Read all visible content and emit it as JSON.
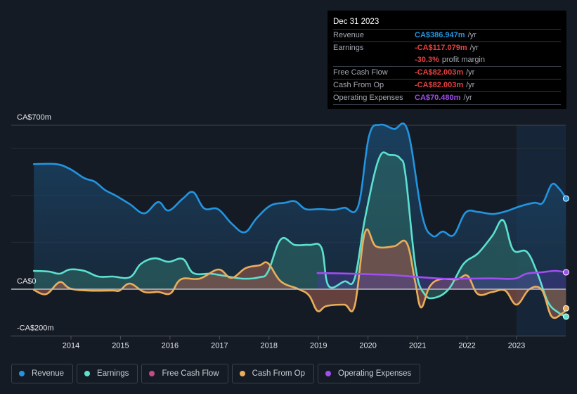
{
  "tooltip": {
    "date": "Dec 31 2023",
    "rows": [
      {
        "label": "Revenue",
        "value": "CA$386.947m",
        "unit": "/yr",
        "color": "#2394df"
      },
      {
        "label": "Earnings",
        "value": "-CA$117.079m",
        "unit": "/yr",
        "color": "#e64141"
      },
      {
        "label": "",
        "value": "-30.3%",
        "unit": "profit margin",
        "color": "#e64141"
      },
      {
        "label": "Free Cash Flow",
        "value": "-CA$82.003m",
        "unit": "/yr",
        "color": "#e64141"
      },
      {
        "label": "Cash From Op",
        "value": "-CA$82.003m",
        "unit": "/yr",
        "color": "#e64141"
      },
      {
        "label": "Operating Expenses",
        "value": "CA$70.480m",
        "unit": "/yr",
        "color": "#a04ef0"
      }
    ]
  },
  "legend": [
    {
      "label": "Revenue",
      "color": "#2394df"
    },
    {
      "label": "Earnings",
      "color": "#5ce1cf"
    },
    {
      "label": "Free Cash Flow",
      "color": "#c44b87"
    },
    {
      "label": "Cash From Op",
      "color": "#e9ae5b"
    },
    {
      "label": "Operating Expenses",
      "color": "#a04ef0"
    }
  ],
  "chart_data": {
    "type": "area",
    "title": "",
    "xlabel": "",
    "ylabel": "",
    "y_unit": "CA$m",
    "ylim": [
      -200,
      700
    ],
    "xlim": [
      2013.25,
      2024.0
    ],
    "y_tick_labels": [
      {
        "value": 700,
        "label": "CA$700m"
      },
      {
        "value": 0,
        "label": "CA$0"
      },
      {
        "value": -200,
        "label": "-CA$200m"
      }
    ],
    "gridlines": [
      700,
      600,
      400,
      200,
      0,
      -200
    ],
    "x_ticks": [
      2014,
      2015,
      2016,
      2017,
      2018,
      2019,
      2020,
      2021,
      2022,
      2023
    ],
    "forecast_shade_from": 2023.0,
    "grid": true,
    "legend_position": "bottom",
    "series": [
      {
        "name": "Revenue",
        "color": "#2394df",
        "x": [
          2013.25,
          2013.7,
          2013.98,
          2014.27,
          2014.48,
          2014.69,
          2014.91,
          2015.19,
          2015.48,
          2015.76,
          2015.97,
          2016.26,
          2016.47,
          2016.69,
          2016.97,
          2017.25,
          2017.51,
          2017.75,
          2018.03,
          2018.32,
          2018.53,
          2018.74,
          2019.03,
          2019.31,
          2019.52,
          2019.8,
          2020.02,
          2020.24,
          2020.52,
          2020.8,
          2021.09,
          2021.3,
          2021.51,
          2021.73,
          2021.97,
          2022.22,
          2022.51,
          2022.79,
          2023.07,
          2023.36,
          2023.53,
          2023.71,
          2023.86,
          2024.0
        ],
        "values": [
          534,
          534,
          513,
          474,
          459,
          423,
          399,
          363,
          324,
          372,
          336,
          387,
          414,
          345,
          342,
          279,
          243,
          303,
          357,
          369,
          375,
          342,
          342,
          339,
          348,
          354,
          654,
          702,
          684,
          678,
          318,
          228,
          246,
          231,
          327,
          330,
          321,
          333,
          354,
          369,
          369,
          447,
          429,
          387
        ]
      },
      {
        "name": "Earnings",
        "color": "#5ce1cf",
        "x": [
          2013.25,
          2013.56,
          2013.77,
          2013.98,
          2014.27,
          2014.55,
          2014.84,
          2015.19,
          2015.41,
          2015.69,
          2015.97,
          2016.26,
          2016.47,
          2016.82,
          2017.1,
          2017.46,
          2017.81,
          2017.98,
          2018.24,
          2018.52,
          2018.81,
          2019.06,
          2019.2,
          2019.52,
          2019.73,
          2019.94,
          2020.22,
          2020.44,
          2020.65,
          2020.76,
          2020.96,
          2021.14,
          2021.36,
          2021.64,
          2021.93,
          2022.22,
          2022.51,
          2022.73,
          2022.93,
          2023.21,
          2023.43,
          2023.64,
          2023.86,
          2024.0
        ],
        "values": [
          78,
          75,
          66,
          84,
          78,
          54,
          54,
          51,
          108,
          132,
          117,
          129,
          69,
          66,
          57,
          45,
          51,
          75,
          213,
          189,
          189,
          177,
          15,
          33,
          45,
          303,
          558,
          573,
          558,
          483,
          93,
          -21,
          -36,
          3,
          108,
          153,
          228,
          294,
          168,
          159,
          63,
          -57,
          -102,
          -117
        ]
      },
      {
        "name": "Free Cash Flow",
        "color": "#c44b87",
        "x": [
          2013.25,
          2013.5,
          2013.77,
          2013.98,
          2014.34,
          2014.84,
          2014.98,
          2015.19,
          2015.48,
          2015.76,
          2016.01,
          2016.22,
          2016.6,
          2016.98,
          2017.24,
          2017.53,
          2017.81,
          2017.98,
          2018.24,
          2018.6,
          2018.81,
          2018.98,
          2019.16,
          2019.52,
          2019.73,
          2019.94,
          2020.16,
          2020.52,
          2020.78,
          2020.95,
          2021.07,
          2021.24,
          2021.45,
          2021.8,
          2022.01,
          2022.22,
          2022.51,
          2022.77,
          2023.0,
          2023.26,
          2023.51,
          2023.71,
          2023.93,
          2024.0
        ],
        "values": [
          -3,
          -21,
          30,
          3,
          -6,
          -6,
          -6,
          24,
          -12,
          -12,
          -18,
          42,
          45,
          84,
          48,
          90,
          102,
          111,
          33,
          0,
          -27,
          -93,
          -72,
          -66,
          -72,
          243,
          183,
          183,
          198,
          33,
          -78,
          9,
          42,
          42,
          57,
          -21,
          -12,
          -6,
          -66,
          0,
          -3,
          -117,
          -102,
          -82
        ]
      },
      {
        "name": "Cash From Op",
        "color": "#e9ae5b",
        "x": [
          2013.25,
          2013.5,
          2013.77,
          2013.98,
          2014.34,
          2014.84,
          2014.98,
          2015.19,
          2015.48,
          2015.76,
          2016.01,
          2016.22,
          2016.6,
          2016.98,
          2017.24,
          2017.53,
          2017.81,
          2017.98,
          2018.24,
          2018.6,
          2018.81,
          2018.98,
          2019.16,
          2019.52,
          2019.73,
          2019.94,
          2020.16,
          2020.52,
          2020.78,
          2020.95,
          2021.07,
          2021.24,
          2021.45,
          2021.8,
          2022.01,
          2022.22,
          2022.51,
          2022.77,
          2023.0,
          2023.26,
          2023.51,
          2023.71,
          2023.93,
          2024.0
        ],
        "values": [
          -3,
          -21,
          30,
          3,
          -6,
          -6,
          -6,
          24,
          -12,
          -12,
          -18,
          42,
          45,
          84,
          48,
          90,
          102,
          111,
          33,
          0,
          -27,
          -93,
          -72,
          -66,
          -72,
          243,
          183,
          183,
          198,
          33,
          -78,
          9,
          42,
          42,
          57,
          -21,
          -12,
          -6,
          -66,
          0,
          -3,
          -117,
          -102,
          -82
        ]
      },
      {
        "name": "Operating Expenses",
        "color": "#a04ef0",
        "x": [
          2018.98,
          2019.5,
          2020.0,
          2020.5,
          2021.0,
          2021.5,
          2022.0,
          2022.5,
          2022.96,
          2023.2,
          2023.5,
          2023.78,
          2024.0
        ],
        "values": [
          69,
          67,
          64,
          60,
          52,
          45,
          45,
          46,
          45,
          66,
          72,
          78,
          72
        ]
      }
    ]
  }
}
